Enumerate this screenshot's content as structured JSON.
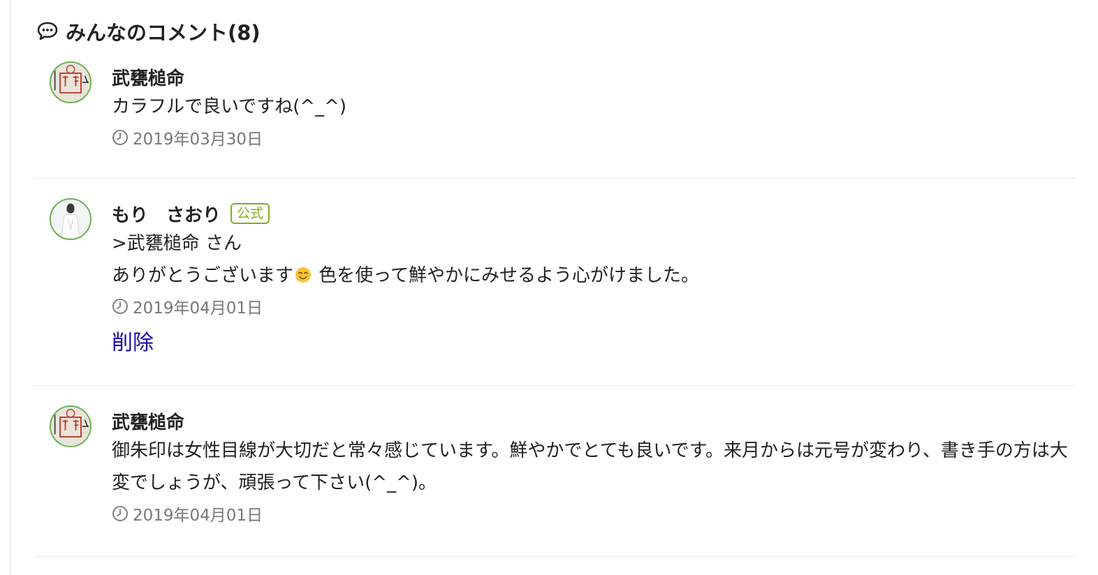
{
  "header": {
    "icon": "speech-bubble-icon",
    "title": "みんなのコメント(8)"
  },
  "comments": [
    {
      "author": "武甕槌命",
      "avatar": "shrine-seal-avatar",
      "badge": "",
      "lines": [
        "カラフルで良いですね(^_^)"
      ],
      "date": "2019年03月30日",
      "delete_label": ""
    },
    {
      "author": "もり　さおり",
      "avatar": "person-photo-avatar",
      "badge": "公式",
      "lines": [
        ">武甕槌命 さん"
      ],
      "line2_before": "ありがとうございます",
      "line2_emoji": "smiling-face-emoji",
      "line2_after": " 色を使って鮮やかにみせるよう心がけました。",
      "date": "2019年04月01日",
      "delete_label": "削除"
    },
    {
      "author": "武甕槌命",
      "avatar": "shrine-seal-avatar",
      "badge": "",
      "lines": [
        "御朱印は女性目線が大切だと常々感じています。鮮やかでとても良いです。来月からは元号が変わり、書き手の方は大変でしょうが、頑張って下さい(^_^)。"
      ],
      "date": "2019年04月01日",
      "delete_label": ""
    }
  ],
  "colors": {
    "accent_green": "#7ab317",
    "link_blue": "#1a0dab",
    "muted_text": "#777777"
  }
}
